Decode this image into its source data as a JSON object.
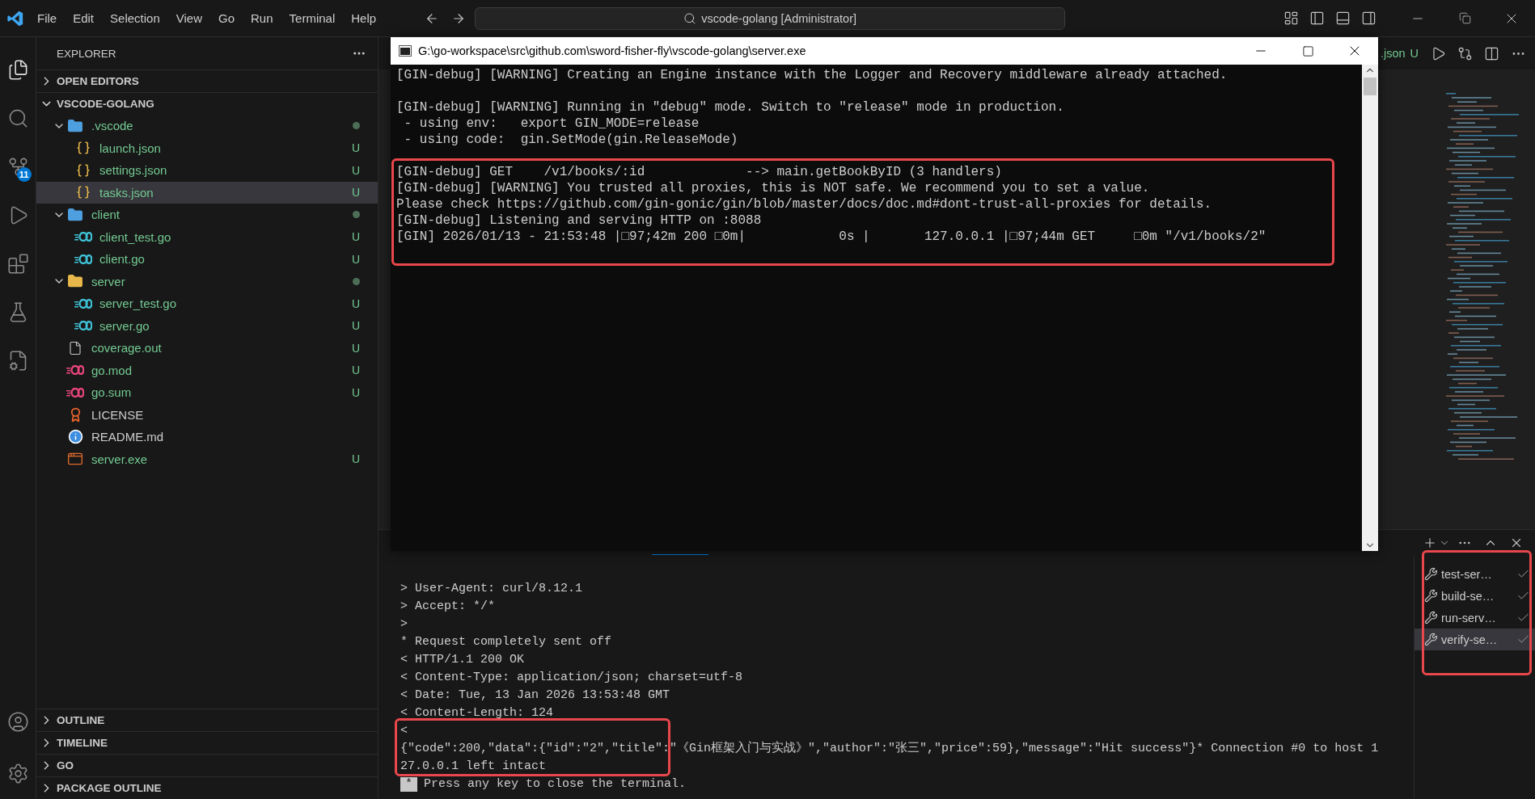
{
  "title_bar": {
    "menu": [
      "File",
      "Edit",
      "Selection",
      "View",
      "Go",
      "Run",
      "Terminal",
      "Help"
    ],
    "search": {
      "value": "vscode-golang [Administrator]"
    }
  },
  "activity_bar": {
    "top": [
      {
        "kind": "files",
        "selected": true
      },
      {
        "kind": "search",
        "selected": false
      },
      {
        "kind": "source-control",
        "selected": false,
        "badge": "11"
      },
      {
        "kind": "run",
        "selected": false
      },
      {
        "kind": "extensions",
        "selected": false
      },
      {
        "kind": "testing",
        "selected": false
      },
      {
        "kind": "remote",
        "selected": false
      }
    ],
    "bottom": [
      {
        "kind": "account"
      },
      {
        "kind": "settings"
      }
    ]
  },
  "sidebar": {
    "title": "EXPLORER",
    "sections": [
      {
        "label": "OPEN EDITORS",
        "expanded": false
      },
      {
        "label": "VSCODE-GOLANG",
        "expanded": true
      }
    ],
    "tree": [
      {
        "name": ".vscode",
        "kind": "folder",
        "color": "#4d9fe0",
        "expanded": true,
        "status_dot": true,
        "selected": false,
        "children": [
          {
            "name": "launch.json",
            "kind": "json",
            "status": "U",
            "selected": false
          },
          {
            "name": "settings.json",
            "kind": "json",
            "status": "U",
            "selected": false
          },
          {
            "name": "tasks.json",
            "kind": "json",
            "status": "U",
            "selected": true
          }
        ]
      },
      {
        "name": "client",
        "kind": "folder",
        "color": "#4d9fe0",
        "expanded": true,
        "status_dot": true,
        "selected": false,
        "children": [
          {
            "name": "client_test.go",
            "kind": "go",
            "status": "U",
            "selected": false
          },
          {
            "name": "client.go",
            "kind": "go",
            "status": "U",
            "selected": false
          }
        ]
      },
      {
        "name": "server",
        "kind": "folder",
        "color": "#e8b84a",
        "expanded": true,
        "status_dot": true,
        "selected": false,
        "children": [
          {
            "name": "server_test.go",
            "kind": "go",
            "status": "U",
            "selected": false
          },
          {
            "name": "server.go",
            "kind": "go",
            "status": "U",
            "selected": false
          }
        ]
      },
      {
        "name": "coverage.out",
        "kind": "file",
        "status": "U",
        "selected": false
      },
      {
        "name": "go.mod",
        "kind": "gomod",
        "status": "U",
        "selected": false
      },
      {
        "name": "go.sum",
        "kind": "gomod",
        "status": "U",
        "selected": false
      },
      {
        "name": "LICENSE",
        "kind": "license",
        "selected": false
      },
      {
        "name": "README.md",
        "kind": "readme",
        "selected": false
      },
      {
        "name": "server.exe",
        "kind": "exe",
        "status": "U",
        "selected": false
      }
    ],
    "bottom_sections": [
      {
        "label": "OUTLINE",
        "expanded": false
      },
      {
        "label": "TIMELINE",
        "expanded": false
      },
      {
        "label": "GO",
        "expanded": false
      },
      {
        "label": "PACKAGE OUTLINE",
        "expanded": false
      }
    ]
  },
  "editor_tab": {
    "label": ".json",
    "status": "U"
  },
  "console_window": {
    "title": "G:\\go-workspace\\src\\github.com\\sword-fisher-fly\\vscode-golang\\server.exe",
    "blocks": [
      [
        "[GIN-debug] [WARNING] Creating an Engine instance with the Logger and Recovery middleware already attached."
      ],
      [
        "[GIN-debug] [WARNING] Running in \"debug\" mode. Switch to \"release\" mode in production.",
        " - using env:   export GIN_MODE=release",
        " - using code:  gin.SetMode(gin.ReleaseMode)"
      ],
      [
        "[GIN-debug] GET    /v1/books/:id             --> main.getBookByID (3 handlers)",
        "[GIN-debug] [WARNING] You trusted all proxies, this is NOT safe. We recommend you to set a value.",
        "Please check https://github.com/gin-gonic/gin/blob/master/docs/doc.md#dont-trust-all-proxies for details.",
        "[GIN-debug] Listening and serving HTTP on :8088",
        "[GIN] 2026/01/13 - 21:53:48 |□97;42m 200 □0m|            0s |       127.0.0.1 |□97;44m GET     □0m \"/v1/books/2\""
      ]
    ]
  },
  "terminal": {
    "lines": [
      "> User-Agent: curl/8.12.1",
      "> Accept: */*",
      ">",
      "* Request completely sent off",
      "< HTTP/1.1 200 OK",
      "< Content-Type: application/json; charset=utf-8",
      "< Date: Tue, 13 Jan 2026 13:53:48 GMT",
      "< Content-Length: 124",
      "<",
      "{\"code\":200,\"data\":{\"id\":\"2\",\"title\":\"《Gin框架入门与实战》\",\"author\":\"张三\",\"price\":59},\"message\":\"Hit success\"}* Connection #0 to host 1",
      "27.0.0.1 left intact"
    ],
    "prompt": {
      "marker": "*",
      "text": "Press any key to close the terminal."
    }
  },
  "tasks": [
    {
      "label": "test-ser…",
      "selected": false
    },
    {
      "label": "build-se…",
      "selected": false
    },
    {
      "label": "run-serv…",
      "selected": false
    },
    {
      "label": "verify-se…",
      "selected": true
    }
  ]
}
